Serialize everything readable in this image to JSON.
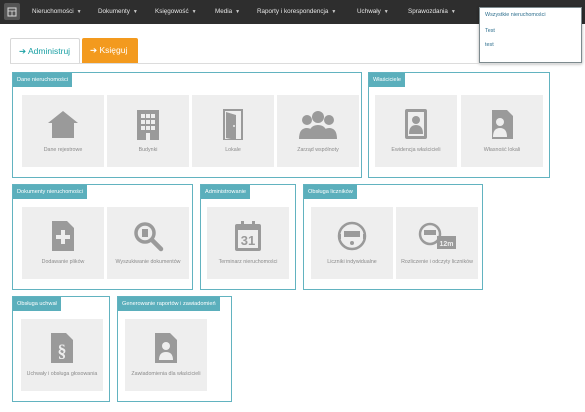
{
  "navbar": {
    "items": [
      {
        "label": "Nieruchomości"
      },
      {
        "label": "Dokumenty"
      },
      {
        "label": "Księgowość"
      },
      {
        "label": "Media"
      },
      {
        "label": "Raporty i korespondencja"
      },
      {
        "label": "Uchwały"
      },
      {
        "label": "Sprawozdania"
      }
    ],
    "dropdown": [
      "Wszystkie nieruchomości",
      "Test",
      "test"
    ]
  },
  "tabs": {
    "admin": "➔ Administruj",
    "ksieguj": "➔ Księguj"
  },
  "panels": {
    "dane": {
      "title": "Dane nieruchomości",
      "tiles": [
        "Dane rejestrowe",
        "Budynki",
        "Lokale",
        "Zarząd wspólnoty"
      ]
    },
    "wlasciciele": {
      "title": "Właściciele",
      "tiles": [
        "Ewidencja właścicieli",
        "Własność lokali"
      ]
    },
    "dokumenty": {
      "title": "Dokumenty nieruchomości",
      "tiles": [
        "Dodawanie plików",
        "Wyszukiwanie dokumentów"
      ]
    },
    "administrowanie": {
      "title": "Administrowanie",
      "tiles": [
        "Terminarz nieruchomości"
      ]
    },
    "liczniki": {
      "title": "Obsługa liczników",
      "tiles": [
        "Liczniki indywidualne",
        "Rozliczenie i odczyty liczników"
      ]
    },
    "uchwaly": {
      "title": "Obsługa uchwał",
      "tiles": [
        "Uchwały i obsługa głosowania"
      ]
    },
    "raporty": {
      "title": "Generowanie raportów i zawiadomień",
      "tiles": [
        "Zawiadomienia dla właścicieli"
      ]
    }
  },
  "icons": {
    "home": "house-icon",
    "budynki": "building-icon",
    "lokale": "door-icon",
    "zarzad": "people-icon",
    "ewidencja": "owner-book-icon",
    "wlasnosc": "owner-doc-icon",
    "dodawanie": "add-file-icon",
    "wyszukiwanie": "search-doc-icon",
    "terminarz": "calendar-icon",
    "calendar_day": "31",
    "liczniki": "meter-icon",
    "odczyty": "meter-reading-icon",
    "meter_unit": "12m",
    "uchwaly": "paragraph-doc-icon",
    "paragraph": "§",
    "zawiadomienia": "notice-doc-icon"
  },
  "colors": {
    "navbar": "#2e2e2e",
    "accent": "#5bafbc",
    "orange": "#f39a1e",
    "tile": "#eeeeee",
    "icon": "#9a9a9a"
  }
}
